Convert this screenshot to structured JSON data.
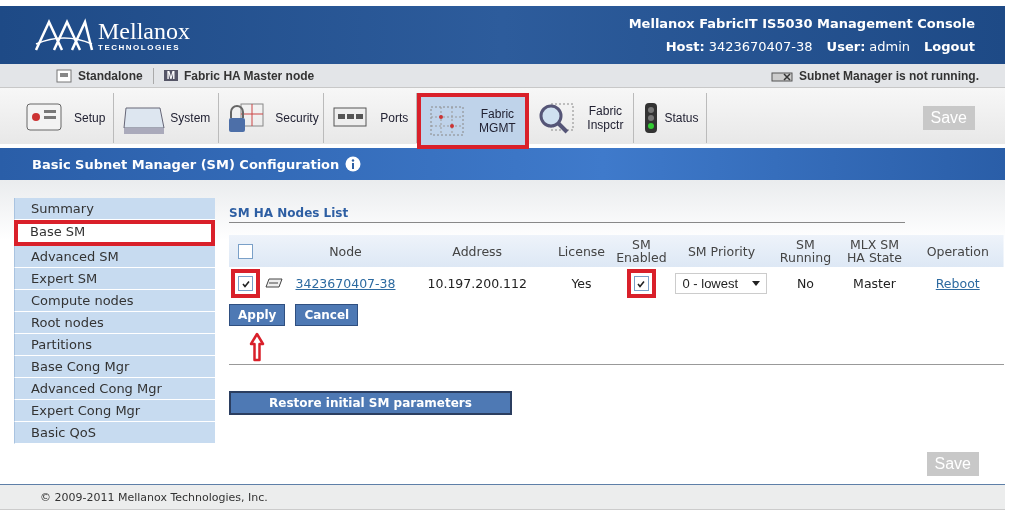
{
  "header": {
    "logo_name": "Mellanox",
    "logo_tagline": "TECHNOLOGIES",
    "title": "Mellanox FabricIT IS5030 Management Console",
    "host_label": "Host:",
    "host": "3423670407-38",
    "user_label": "User:",
    "user": "admin",
    "logout": "Logout"
  },
  "status_bar": {
    "mode": "Standalone",
    "ha_icon_letter": "M",
    "ha_role": "Fabric HA Master node",
    "sm_status": "Subnet Manager is not running."
  },
  "toolbar": {
    "tabs": [
      {
        "kind": "setup",
        "label": "Setup",
        "selected": false,
        "highlighted": false
      },
      {
        "kind": "system",
        "label": "System",
        "selected": false,
        "highlighted": false
      },
      {
        "kind": "security",
        "label": "Security",
        "selected": false,
        "highlighted": false
      },
      {
        "kind": "ports",
        "label": "Ports",
        "selected": false,
        "highlighted": false
      },
      {
        "kind": "grid",
        "label": "Fabric MGMT",
        "selected": true,
        "highlighted": true
      },
      {
        "kind": "inspect",
        "label": "Fabric Inspctr",
        "selected": false,
        "highlighted": false
      },
      {
        "kind": "status",
        "label": "Status",
        "selected": false,
        "highlighted": false
      }
    ],
    "save": {
      "label": "Save",
      "disabled": true
    }
  },
  "section_title": "Basic Subnet Manager (SM) Configuration",
  "sidebar": {
    "items": [
      {
        "label": "Summary",
        "selected": false,
        "highlighted": false
      },
      {
        "label": "Base SM",
        "selected": true,
        "highlighted": true
      },
      {
        "label": "Advanced SM",
        "selected": false,
        "highlighted": false
      },
      {
        "label": "Expert SM",
        "selected": false,
        "highlighted": false
      },
      {
        "label": "Compute nodes",
        "selected": false,
        "highlighted": false
      },
      {
        "label": "Root nodes",
        "selected": false,
        "highlighted": false
      },
      {
        "label": "Partitions",
        "selected": false,
        "highlighted": false
      },
      {
        "label": "Base Cong Mgr",
        "selected": false,
        "highlighted": false
      },
      {
        "label": "Advanced Cong Mgr",
        "selected": false,
        "highlighted": false
      },
      {
        "label": "Expert Cong Mgr",
        "selected": false,
        "highlighted": false
      },
      {
        "label": "Basic QoS",
        "selected": false,
        "highlighted": false
      }
    ]
  },
  "nodes": {
    "heading": "SM HA Nodes List",
    "select_all": {
      "checked": false
    },
    "columns": [
      "Node",
      "Address",
      "License",
      "SM Enabled",
      "SM Priority",
      "SM Running",
      "MLX SM HA State",
      "Operation"
    ],
    "rows": [
      {
        "checked": true,
        "check_highlighted": true,
        "node": "3423670407-38",
        "address": "10.197.200.112",
        "license": "Yes",
        "sm_enabled": true,
        "sm_enabled_highlighted": true,
        "priority": "0 - lowest",
        "running": "No",
        "ha_state": "Master",
        "operation": "Reboot"
      }
    ],
    "apply": {
      "label": "Apply",
      "pointer_arrow": true
    },
    "cancel": "Cancel",
    "restore": "Restore initial SM parameters"
  },
  "bottom_save": {
    "label": "Save",
    "disabled": true
  },
  "footer": "© 2009-2011 Mellanox Technologies, Inc."
}
